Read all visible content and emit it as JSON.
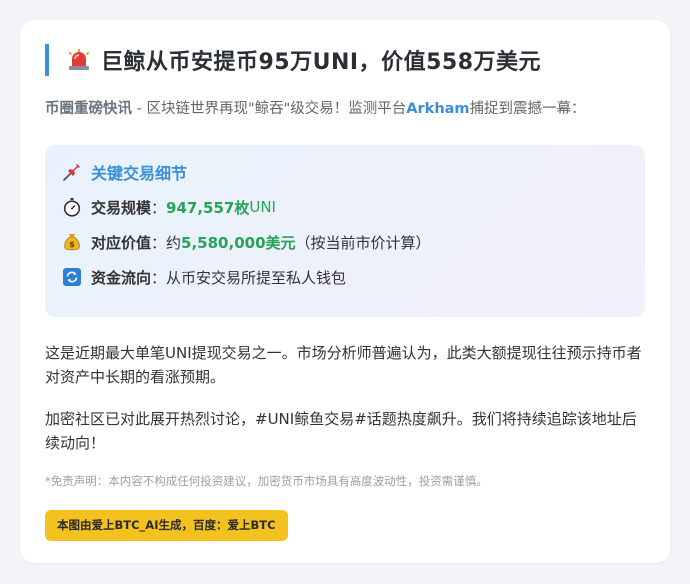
{
  "title": "巨鲸从币安提币95万UNI，价值558万美元",
  "lead": {
    "tag": "币圈重磅快讯",
    "text_before": " - 区块链世界再现\"鲸吞\"级交易！监测平台",
    "brand": "Arkham",
    "text_after": "捕捉到震撼一幕："
  },
  "details": {
    "heading": "关键交易细节",
    "scale_label": "交易规模",
    "scale_value": "947,557枚",
    "scale_unit": " UNI",
    "value_label": "对应价值",
    "value_prefix": "约",
    "value_amount": "5,580,000美元",
    "value_note": "（按当前市价计算）",
    "flow_label": "资金流向",
    "flow_value": "从币安交易所提至私人钱包",
    "separator": "："
  },
  "paragraphs": [
    "这是近期最大单笔UNI提现交易之一。市场分析师普遍认为，此类大额提现往往预示持币者对资产中长期的看涨预期。",
    "加密社区已对此展开热烈讨论，#UNI鲸鱼交易#话题热度飙升。我们将持续追踪该地址后续动向！"
  ],
  "disclaimer": "*免责声明：本内容不构成任何投资建议，加密货币市场具有高度波动性，投资需谨慎。",
  "badge": "本图由爱上BTC_AI生成，百度：爱上BTC",
  "icons": {
    "title": "siren-icon",
    "heading": "pushpin-icon",
    "scale": "stopwatch-icon",
    "value": "money-bag-icon",
    "flow": "refresh-icon"
  },
  "colors": {
    "accent": "#3a8fd8",
    "green": "#27a356",
    "badge": "#f4c21f"
  }
}
